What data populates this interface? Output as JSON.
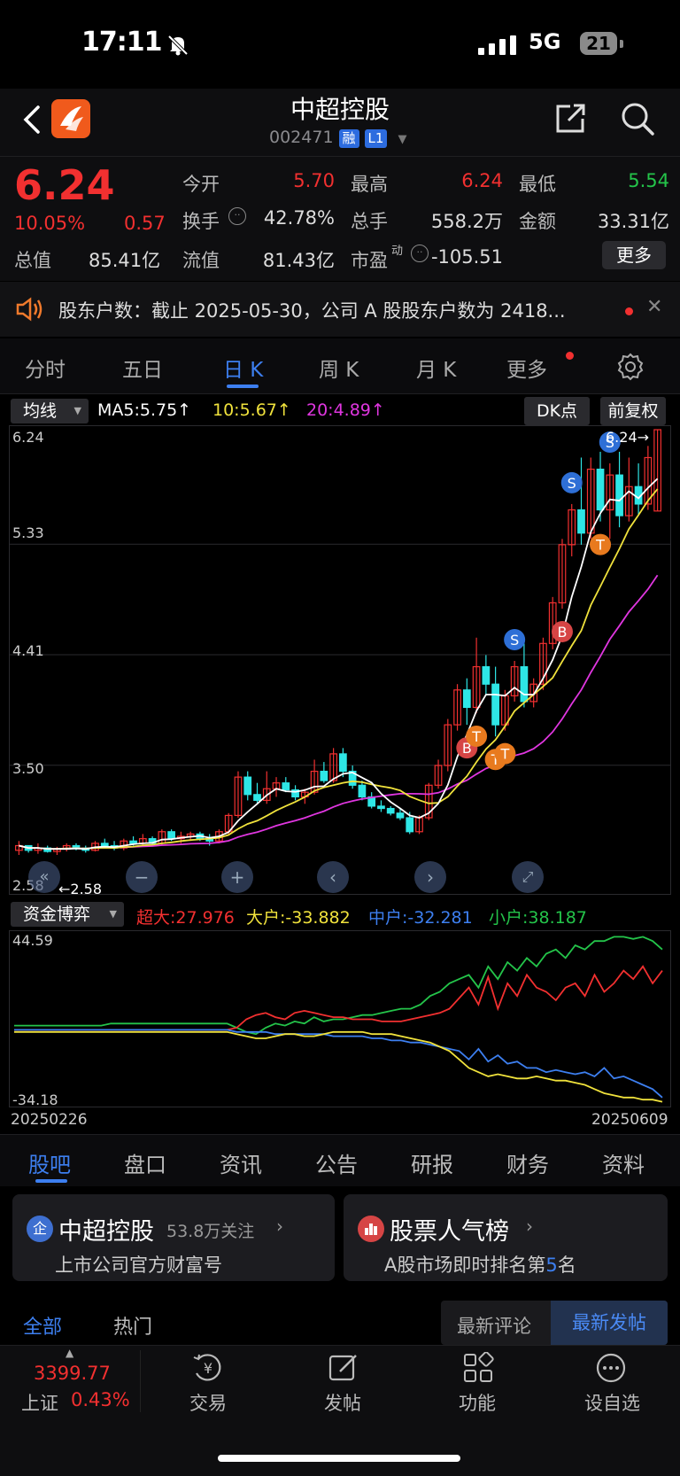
{
  "status_bar": {
    "time": "17:11",
    "network": "5G",
    "battery": "21"
  },
  "header": {
    "title": "中超控股",
    "code": "002471",
    "tags": [
      "融",
      "L1"
    ]
  },
  "quote": {
    "price": "6.24",
    "change_pct": "10.05%",
    "change": "0.57",
    "open_label": "今开",
    "open": "5.70",
    "high_label": "最高",
    "high": "6.24",
    "low_label": "最低",
    "low": "5.54",
    "turnover_label": "换手",
    "turnover": "42.78%",
    "volume_label": "总手",
    "volume": "558.2万",
    "amount_label": "金额",
    "amount": "33.31亿",
    "mktcap_label": "总值",
    "mktcap": "85.41亿",
    "float_label": "流值",
    "float_cap": "81.43亿",
    "pe_label": "市盈",
    "pe_sup": "动",
    "pe": "-105.51",
    "more": "更多"
  },
  "notice": {
    "text": "股东户数：截止 2025-05-30，公司 A 股股东户数为 2418..."
  },
  "period_tabs": [
    "分时",
    "五日",
    "日 K",
    "周 K",
    "月 K",
    "更多"
  ],
  "active_period": "日 K",
  "indicators": {
    "ma_selector": "均线",
    "ma5": "MA5:5.75↑",
    "ma10": "10:5.67↑",
    "ma20": "20:4.89↑",
    "dk": "DK点",
    "adjust": "前复权",
    "ma5_color": "#ffffff",
    "ma10_color": "#f0e23c",
    "ma20_color": "#e036e0"
  },
  "kline": {
    "y_labels": [
      "6.24",
      "5.33",
      "4.41",
      "3.50",
      "2.58"
    ],
    "max_label": "6.24→",
    "min_label": "←2.58",
    "up_color": "#f23030",
    "down_color": "#2ee6e6",
    "signals": [
      {
        "type": "B",
        "date_index": 47
      },
      {
        "type": "T",
        "date_index": 48
      },
      {
        "type": "T",
        "date_index": 50
      },
      {
        "type": "T",
        "date_index": 51
      },
      {
        "type": "S",
        "date_index": 52
      },
      {
        "type": "B",
        "date_index": 57
      },
      {
        "type": "S",
        "date_index": 58
      },
      {
        "type": "T",
        "date_index": 61
      },
      {
        "type": "S",
        "date_index": 62
      }
    ],
    "candles": [
      [
        2.62,
        2.7,
        2.58,
        2.66
      ],
      [
        2.66,
        2.66,
        2.6,
        2.62
      ],
      [
        2.62,
        2.68,
        2.59,
        2.64
      ],
      [
        2.64,
        2.66,
        2.6,
        2.61
      ],
      [
        2.61,
        2.65,
        2.58,
        2.63
      ],
      [
        2.63,
        2.68,
        2.61,
        2.66
      ],
      [
        2.66,
        2.68,
        2.62,
        2.64
      ],
      [
        2.64,
        2.66,
        2.6,
        2.62
      ],
      [
        2.62,
        2.7,
        2.61,
        2.68
      ],
      [
        2.68,
        2.72,
        2.64,
        2.66
      ],
      [
        2.66,
        2.7,
        2.62,
        2.64
      ],
      [
        2.64,
        2.72,
        2.62,
        2.7
      ],
      [
        2.7,
        2.74,
        2.66,
        2.68
      ],
      [
        2.68,
        2.76,
        2.66,
        2.72
      ],
      [
        2.72,
        2.74,
        2.66,
        2.68
      ],
      [
        2.68,
        2.8,
        2.66,
        2.78
      ],
      [
        2.78,
        2.8,
        2.7,
        2.72
      ],
      [
        2.72,
        2.78,
        2.68,
        2.74
      ],
      [
        2.74,
        2.78,
        2.7,
        2.76
      ],
      [
        2.76,
        2.78,
        2.7,
        2.72
      ],
      [
        2.72,
        2.76,
        2.66,
        2.7
      ],
      [
        2.7,
        2.8,
        2.68,
        2.78
      ],
      [
        2.78,
        2.94,
        2.76,
        2.92
      ],
      [
        2.92,
        3.3,
        2.9,
        3.25
      ],
      [
        3.25,
        3.3,
        3.05,
        3.1
      ],
      [
        3.1,
        3.2,
        3.02,
        3.05
      ],
      [
        3.05,
        3.3,
        3.02,
        3.15
      ],
      [
        3.15,
        3.25,
        3.08,
        3.2
      ],
      [
        3.2,
        3.25,
        3.12,
        3.14
      ],
      [
        3.14,
        3.18,
        3.05,
        3.08
      ],
      [
        3.08,
        3.15,
        3.02,
        3.12
      ],
      [
        3.12,
        3.4,
        3.1,
        3.3
      ],
      [
        3.3,
        3.38,
        3.2,
        3.22
      ],
      [
        3.22,
        3.5,
        3.2,
        3.45
      ],
      [
        3.45,
        3.5,
        3.25,
        3.3
      ],
      [
        3.3,
        3.35,
        3.15,
        3.18
      ],
      [
        3.18,
        3.22,
        3.05,
        3.08
      ],
      [
        3.08,
        3.12,
        2.98,
        3.0
      ],
      [
        3.0,
        3.05,
        2.95,
        2.98
      ],
      [
        2.98,
        3.0,
        2.92,
        2.94
      ],
      [
        2.94,
        2.98,
        2.88,
        2.9
      ],
      [
        2.9,
        2.95,
        2.76,
        2.78
      ],
      [
        2.78,
        2.92,
        2.76,
        2.9
      ],
      [
        2.9,
        3.2,
        2.88,
        3.18
      ],
      [
        3.18,
        3.4,
        3.15,
        3.35
      ],
      [
        3.35,
        3.75,
        3.3,
        3.7
      ],
      [
        3.7,
        4.05,
        3.65,
        4.0
      ],
      [
        4.0,
        4.1,
        3.7,
        3.85
      ],
      [
        3.85,
        4.45,
        3.8,
        4.2
      ],
      [
        4.2,
        4.3,
        3.95,
        4.05
      ],
      [
        4.05,
        4.2,
        3.6,
        3.7
      ],
      [
        3.7,
        4.0,
        3.65,
        3.95
      ],
      [
        3.95,
        4.25,
        3.9,
        4.2
      ],
      [
        4.2,
        4.4,
        3.85,
        3.9
      ],
      [
        3.9,
        4.1,
        3.85,
        4.05
      ],
      [
        4.05,
        4.45,
        4.0,
        4.4
      ],
      [
        4.4,
        4.8,
        4.35,
        4.75
      ],
      [
        4.75,
        5.3,
        4.7,
        5.25
      ],
      [
        5.25,
        5.6,
        5.15,
        5.55
      ],
      [
        5.55,
        6.0,
        5.25,
        5.35
      ],
      [
        5.35,
        6.0,
        5.3,
        5.9
      ],
      [
        5.9,
        6.05,
        5.45,
        5.55
      ],
      [
        5.55,
        5.95,
        5.3,
        5.85
      ],
      [
        5.85,
        6.05,
        5.4,
        5.5
      ],
      [
        5.5,
        6.0,
        5.45,
        5.75
      ],
      [
        5.75,
        5.95,
        5.5,
        5.6
      ],
      [
        5.6,
        6.1,
        5.55,
        6.0
      ],
      [
        5.54,
        6.24,
        5.54,
        6.24
      ]
    ]
  },
  "fund_flow": {
    "selector": "资金博弈",
    "super_label": "超大:27.976",
    "large_label": "大户:-33.882",
    "medium_label": "中户:-32.281",
    "small_label": "小户:38.187",
    "y_max": "44.59",
    "y_min": "-34.18",
    "date_start": "20250226",
    "date_end": "20250609",
    "colors": {
      "super": "#f23030",
      "large": "#f0e23c",
      "medium": "#3d7ff0",
      "small": "#24c44a"
    },
    "series": {
      "super": [
        0,
        0,
        0,
        0,
        0,
        0,
        0,
        0,
        0,
        0,
        0,
        0,
        0,
        0,
        0,
        0,
        0,
        0,
        0,
        0,
        0,
        0,
        0,
        1,
        5,
        7,
        8,
        6,
        5,
        8,
        9,
        8,
        7,
        6,
        6,
        5,
        5,
        5,
        4,
        4,
        4,
        5,
        6,
        7,
        8,
        10,
        15,
        20,
        12,
        25,
        10,
        22,
        16,
        26,
        20,
        18,
        14,
        20,
        22,
        16,
        26,
        18,
        22,
        28,
        24,
        30,
        22,
        28
      ],
      "large": [
        -1,
        -1,
        -1,
        -1,
        -1,
        -1,
        -1,
        -1,
        -1,
        -1,
        -1,
        -1,
        -1,
        -1,
        -1,
        -1,
        -1,
        -1,
        -1,
        -1,
        -1,
        -1,
        -1,
        -2,
        -3,
        -4,
        -4,
        -3,
        -2,
        -2,
        -3,
        -3,
        -2,
        -1,
        -1,
        -1,
        -1,
        -2,
        -2,
        -2,
        -3,
        -4,
        -5,
        -6,
        -8,
        -10,
        -14,
        -18,
        -20,
        -22,
        -21,
        -22,
        -23,
        -23,
        -22,
        -23,
        -24,
        -24,
        -25,
        -26,
        -28,
        -30,
        -31,
        -32,
        -32,
        -33,
        -33,
        -34
      ],
      "medium": [
        0,
        0,
        0,
        0,
        0,
        0,
        0,
        0,
        0,
        0,
        0,
        0,
        0,
        0,
        0,
        0,
        0,
        0,
        0,
        0,
        0,
        0,
        0,
        -1,
        -1,
        -1,
        -1,
        -2,
        -2,
        -2,
        -2,
        -2,
        -2,
        -3,
        -3,
        -3,
        -3,
        -4,
        -4,
        -5,
        -5,
        -6,
        -6,
        -7,
        -8,
        -9,
        -10,
        -14,
        -9,
        -15,
        -12,
        -16,
        -15,
        -18,
        -18,
        -20,
        -19,
        -20,
        -21,
        -20,
        -22,
        -18,
        -23,
        -22,
        -24,
        -26,
        -28,
        -32
      ],
      "small": [
        2,
        2,
        2,
        2,
        2,
        2,
        2,
        2,
        2,
        2,
        3,
        3,
        3,
        3,
        3,
        3,
        3,
        3,
        3,
        3,
        3,
        3,
        3,
        1,
        -1,
        -2,
        1,
        3,
        2,
        4,
        3,
        6,
        4,
        5,
        5,
        6,
        7,
        7,
        8,
        9,
        10,
        10,
        12,
        16,
        18,
        22,
        24,
        26,
        20,
        30,
        24,
        32,
        28,
        34,
        30,
        36,
        38,
        34,
        40,
        38,
        42,
        42,
        44,
        44,
        43,
        44,
        42,
        38
      ]
    }
  },
  "bottom_tabs": [
    "股吧",
    "盘口",
    "资讯",
    "公告",
    "研报",
    "财务",
    "资料"
  ],
  "active_bottom_tab": "股吧",
  "card_company": {
    "icon_text": "企",
    "name": "中超控股",
    "followers": "53.8万关注",
    "sub": "上市公司官方财富号"
  },
  "card_rank": {
    "name": "股票人气榜",
    "sub_prefix": "A股市场即时排名第",
    "rank": "5",
    "sub_suffix": "名"
  },
  "feed_filter": {
    "all": "全部",
    "hot": "热门",
    "latest_comment": "最新评论",
    "latest_post": "最新发帖"
  },
  "bottom_nav": {
    "index_value": "3399.77",
    "index_name": "上证",
    "index_pct": "0.43%",
    "items": [
      "交易",
      "发帖",
      "功能",
      "设自选"
    ]
  }
}
